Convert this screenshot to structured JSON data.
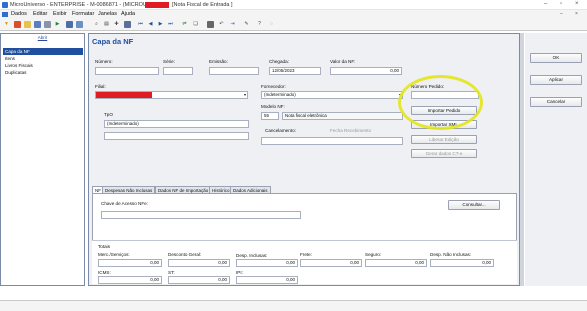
{
  "window": {
    "title": "MicroUniverso - ENTERPRISE - M-0086871 - (MICROUNI)",
    "doc_title": "[Nota Fiscal de Entrada ]"
  },
  "menu": [
    "Dados",
    "Editar",
    "Exibir",
    "Formatar",
    "Janelas",
    "Ajuda"
  ],
  "sidebar": {
    "header": "Abrir",
    "items": [
      "Capa da NF",
      "Itens",
      "Livros Fiscais",
      "Duplicatas"
    ]
  },
  "form": {
    "title": "Capa da NF",
    "numero_label": "Número:",
    "serie_label": "Série:",
    "emissao_label": "Emissão:",
    "chegada_label": "Chegada:",
    "chegada_value": "12/05/2023",
    "valor_label": "Valor da NF:",
    "valor_value": "0,00",
    "filial_label": "Filial:",
    "fornecedor_label": "Fornecedor:",
    "fornecedor_value": "(Indeterminado)",
    "numero_pedido_label": "Número Pedido:",
    "tipo_label": "TpO",
    "tipo_value": "(Indeterminado)",
    "modelo_label": "Modelo NF:",
    "modelo_code": "55",
    "modelo_value": "Nota fiscal eletrônica",
    "cancelamento_label": "Cancelamento:",
    "fechado_label": "Fecha Recebimento"
  },
  "buttons": {
    "importar_pedido": "Importar Pedido",
    "importar_xml": "Importar XML",
    "liberar_edicao": "Liberar Edição",
    "gerar_cte": "Gerar dados CT-e",
    "consultar": "Consultar...",
    "ok": "OK",
    "aplicar": "Aplicar",
    "cancelar": "Cancelar"
  },
  "tabs": [
    "NF",
    "Despesas Não Inclusas",
    "Dados NF de Importação",
    "Histórico",
    "Dados Adicionais"
  ],
  "tab_nf": {
    "chave_label": "Chave de Acesso NFe:"
  },
  "totals": {
    "title": "Totais",
    "row1": [
      {
        "label": "Merc./Serviços:",
        "value": "0,00"
      },
      {
        "label": "Desconto Geral:",
        "value": "0,00"
      },
      {
        "label": "Desp. Inclusas:",
        "value": "0,00"
      },
      {
        "label": "Frete:",
        "value": "0,00"
      },
      {
        "label": "Seguro:",
        "value": "0,00"
      },
      {
        "label": "Desp. Não Inclusas:",
        "value": "0,00"
      }
    ],
    "row2": [
      {
        "label": "ICMS:",
        "value": "0,00"
      },
      {
        "label": "ST:",
        "value": "0,00"
      },
      {
        "label": "IPI:",
        "value": "0,00"
      }
    ]
  },
  "colors": {
    "accent": "#1f4f9e",
    "highlight": "#e3e61a",
    "redacted": "#e01b24"
  }
}
